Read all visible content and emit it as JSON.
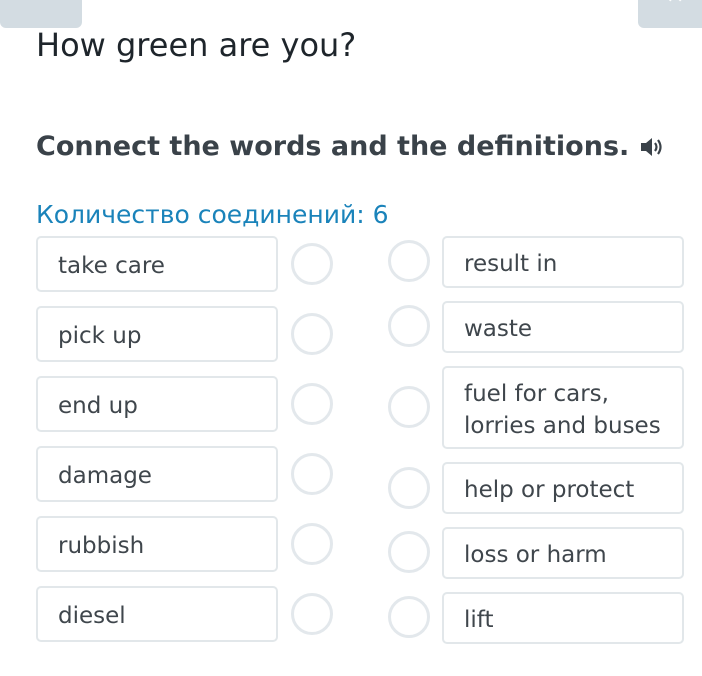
{
  "title": "How green are you?",
  "instruction": "Connect the words and the definitions.",
  "counter": "Количество соединений: 6",
  "icons": {
    "audio": "speaker-icon",
    "menu": "menu-icon",
    "close": "close-icon"
  },
  "colors": {
    "accent": "#1a83ba",
    "card_border": "#e2e7ea",
    "circle_border": "#e3e8ec"
  },
  "left_items": [
    "take care",
    "pick up",
    "end up",
    "damage",
    "rubbish",
    "diesel"
  ],
  "right_items": [
    "result in",
    "waste",
    "fuel for cars,\nlorries and buses",
    "help or protect",
    "loss or harm",
    "lift"
  ]
}
